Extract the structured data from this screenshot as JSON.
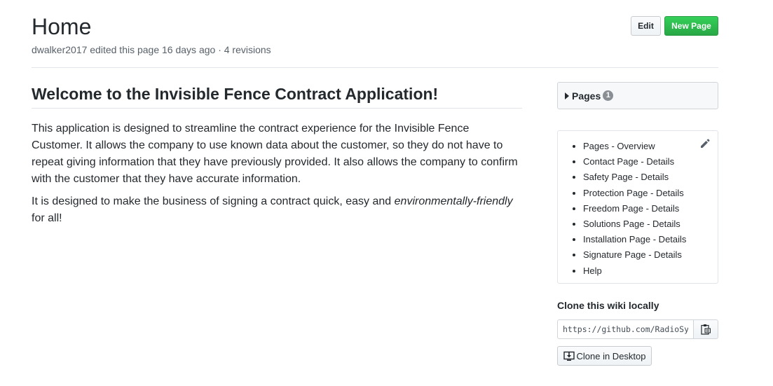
{
  "header": {
    "title": "Home",
    "meta": "dwalker2017 edited this page 16 days ago · 4 revisions",
    "edit_label": "Edit",
    "new_page_label": "New Page"
  },
  "content": {
    "heading": "Welcome to the Invisible Fence Contract Application!",
    "paragraph1": "This application is designed to streamline the contract experience for the Invisible Fence Customer. It allows the company to use known data about the customer, so they do not have to repeat giving information that they have previously provided. It also allows the company to confirm with the customer that they have accurate information.",
    "paragraph2_prefix": "It is designed to make the business of signing a contract quick, easy and ",
    "paragraph2_emphasis": "environmentally-friendly",
    "paragraph2_suffix": " for all!"
  },
  "sidebar": {
    "pages_label": "Pages",
    "pages_count": "1",
    "toc": [
      "Pages - Overview",
      "Contact Page - Details",
      "Safety Page - Details",
      "Protection Page - Details",
      "Freedom Page - Details",
      "Solutions Page - Details",
      "Installation Page - Details",
      "Signature Page - Details",
      "Help"
    ],
    "clone_title": "Clone this wiki locally",
    "clone_url": "https://github.com/RadioSys",
    "clone_desktop_label": "Clone in Desktop"
  },
  "colors": {
    "primary_button": "#28a745",
    "text": "#24292e",
    "muted": "#586069",
    "border": "#e1e4e8"
  },
  "icons": [
    "caret-right-icon",
    "pencil-icon",
    "clipboard-icon",
    "desktop-download-icon"
  ]
}
